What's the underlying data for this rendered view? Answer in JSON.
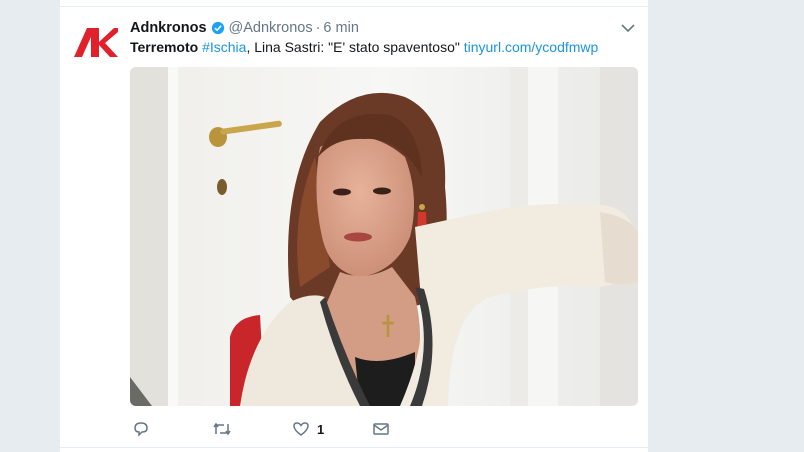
{
  "tweet": {
    "author_name": "Adnkronos",
    "handle": "@Adnkronos",
    "separator": "·",
    "time": "6 min",
    "text_bold": "Terremoto",
    "hashtag": "#Ischia",
    "text_rest": ", Lina Sastri: \"E' stato spaventoso\" ",
    "link": "tinyurl.com/ycodfmwp",
    "like_count": "1"
  },
  "icons": {
    "verified": "verified-badge-icon",
    "menu": "chevron-down-icon",
    "reply": "reply-icon",
    "retweet": "retweet-icon",
    "like": "heart-icon",
    "dm": "envelope-icon"
  },
  "colors": {
    "brand_red": "#e0202b",
    "link_blue": "#1b95e0",
    "background": "#e6ecf0",
    "muted": "#657786"
  }
}
